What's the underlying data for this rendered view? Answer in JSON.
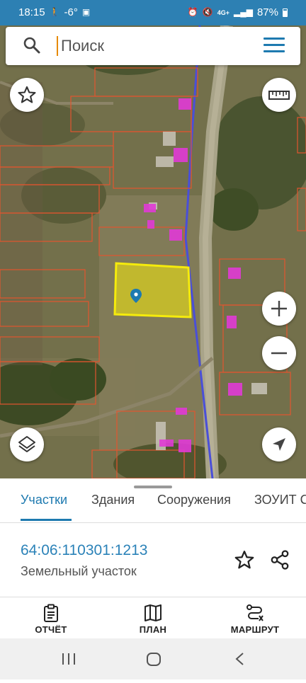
{
  "status_bar": {
    "time": "18:15",
    "temperature": "-6°",
    "network": "4G+",
    "battery": "87%",
    "icons": [
      "walking-icon",
      "image-icon",
      "alarm-icon",
      "mute-icon",
      "signal-icon",
      "battery-icon"
    ]
  },
  "search": {
    "placeholder": "Поиск"
  },
  "map": {
    "highlight_color": "#f5eb0c",
    "boundary_color": "#e2552f",
    "building_color": "#e13ad6",
    "controls": [
      "favorites-star-icon",
      "ruler-icon",
      "zoom-in-icon",
      "zoom-out-icon",
      "layers-icon",
      "my-location-icon"
    ]
  },
  "tabs": [
    {
      "label": "Участки",
      "active": true
    },
    {
      "label": "Здания",
      "active": false
    },
    {
      "label": "Сооружения",
      "active": false
    },
    {
      "label": "ЗОУИТ С",
      "active": false
    }
  ],
  "result": {
    "cadastral_number": "64:06:110301:1213",
    "type": "Земельный участок"
  },
  "bottom_nav": {
    "report_label": "ОТЧЁТ",
    "plan_label": "ПЛАН",
    "route_label": "МАРШРУТ"
  },
  "colors": {
    "accent": "#1e7ab0",
    "status_bar": "#2d80b3",
    "link": "#2b82b8"
  }
}
